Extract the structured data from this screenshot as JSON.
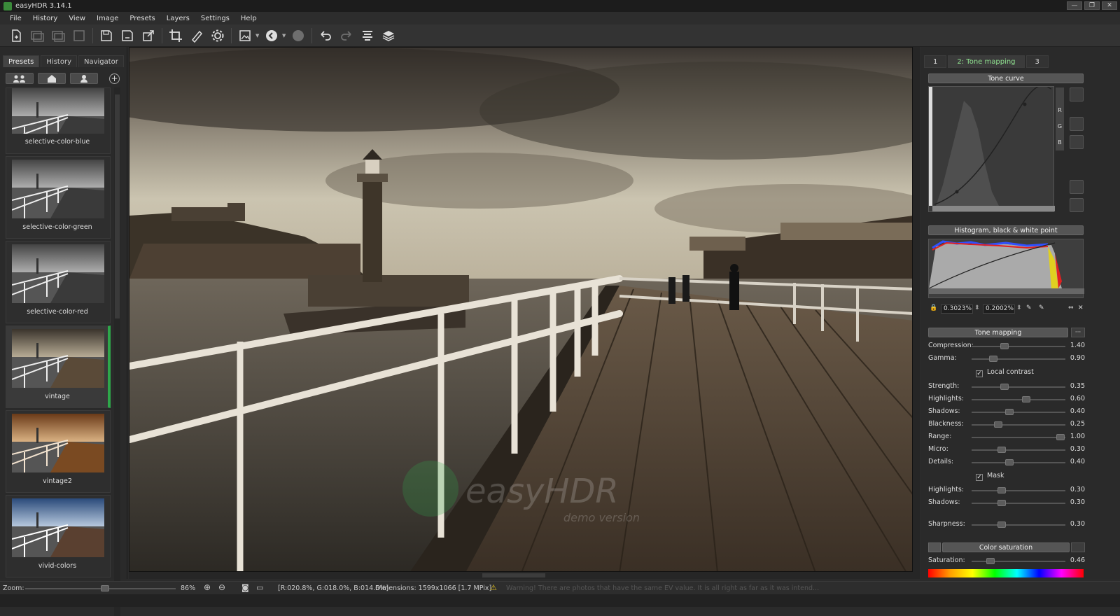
{
  "app": {
    "title": "easyHDR 3.14.1"
  },
  "menu": [
    "File",
    "History",
    "View",
    "Image",
    "Presets",
    "Layers",
    "Settings",
    "Help"
  ],
  "left_panel": {
    "tabs": [
      "Presets",
      "History",
      "Navigator"
    ],
    "presets": [
      {
        "label": "selective-color-blue",
        "tone": "bw"
      },
      {
        "label": "selective-color-green",
        "tone": "bw"
      },
      {
        "label": "selective-color-red",
        "tone": "bw"
      },
      {
        "label": "vintage",
        "tone": "sepia",
        "selected": true
      },
      {
        "label": "vintage2",
        "tone": "warm"
      },
      {
        "label": "vivid-colors",
        "tone": "color"
      }
    ]
  },
  "right_panel": {
    "tabs": [
      "1",
      "2: Tone mapping",
      "3"
    ],
    "tone_curve_header": "Tone curve",
    "curve_channels": [
      "R",
      "G",
      "B"
    ],
    "histogram_header": "Histogram, black & white point",
    "black_point": "0.3023%",
    "white_point": "0.2002%",
    "tone_mapping_header": "Tone mapping",
    "tone_mapping_more": "···",
    "sliders_top": [
      {
        "label": "Compression:",
        "value": "1.40",
        "level": 0.35
      },
      {
        "label": "Gamma:",
        "value": "0.90",
        "level": 0.23
      }
    ],
    "local_contrast_label": "Local contrast",
    "sliders_mid": [
      {
        "label": "Strength:",
        "value": "0.35",
        "level": 0.35
      },
      {
        "label": "Highlights:",
        "value": "0.60",
        "level": 0.58
      },
      {
        "label": "Shadows:",
        "value": "0.40",
        "level": 0.4
      },
      {
        "label": "Blackness:",
        "value": "0.25",
        "level": 0.28
      },
      {
        "label": "Range:",
        "value": "1.00",
        "level": 0.95
      },
      {
        "label": "Micro:",
        "value": "0.30",
        "level": 0.32
      },
      {
        "label": "Details:",
        "value": "0.40",
        "level": 0.4
      }
    ],
    "mask_label": "Mask",
    "sliders_mask": [
      {
        "label": "Highlights:",
        "value": "0.30",
        "level": 0.32
      },
      {
        "label": "Shadows:",
        "value": "0.30",
        "level": 0.32
      }
    ],
    "sharpness": {
      "label": "Sharpness:",
      "value": "0.30",
      "level": 0.32
    },
    "color_saturation_header": "Color saturation",
    "saturation": {
      "label": "Saturation:",
      "value": "0.46",
      "level": 0.2
    }
  },
  "status": {
    "zoom_label": "Zoom:",
    "zoom_value": "86%",
    "pixel_info": "[R:020.8%, G:018.0%, B:014.6%]",
    "dimensions": "Dimensions:  1599x1066 [1.7 MPix]",
    "warning": "Warning! There are photos that have the same EV value. It is all right as far as it was intend..."
  },
  "watermark": {
    "main": "easyHDR",
    "sub": "demo version"
  },
  "colors": {
    "accent_green": "#2ea84a",
    "tab_active_text": "#8fe08f"
  }
}
